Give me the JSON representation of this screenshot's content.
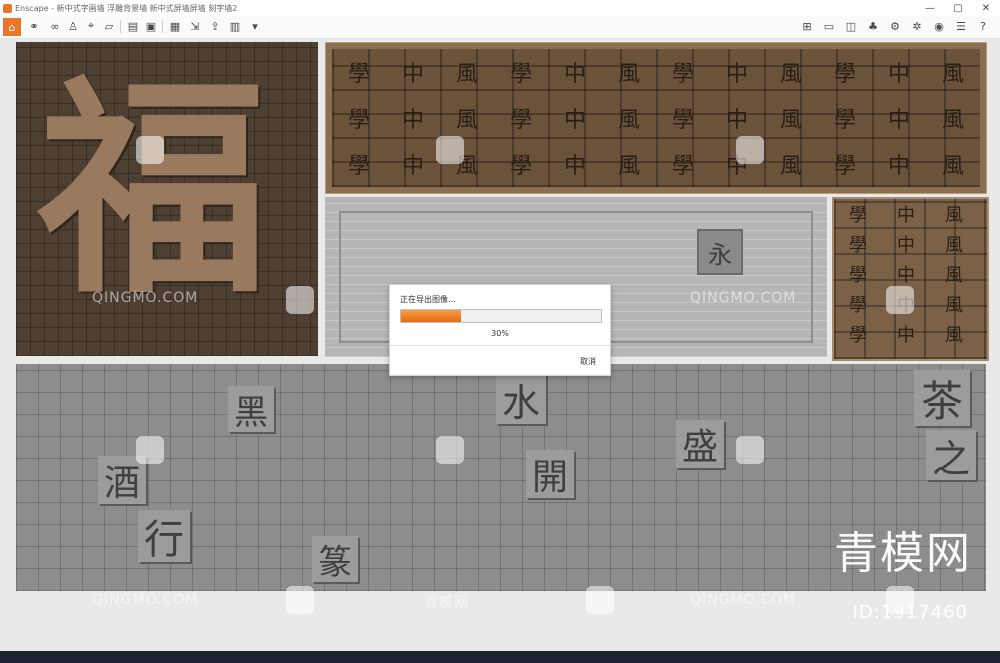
{
  "app": {
    "title": "Enscape - 新中式字画墙 浮雕背景墙 新中式屏墙屏墙 刻字墙2",
    "window_controls": [
      "—",
      "▢",
      "✕"
    ],
    "accent": "#e8762b"
  },
  "toolbar": {
    "left_icons": [
      "home-icon",
      "link-icon",
      "binoculars-icon",
      "person-icon",
      "map-pin-icon",
      "bookmark-icon",
      "clapper-icon",
      "screenshot-icon",
      "batch-render-icon",
      "export-icon",
      "upload-icon",
      "layout-icon"
    ],
    "right_icons": [
      "map-icon",
      "panorama-icon",
      "cube-icon",
      "assets-icon",
      "settings-icon",
      "eye-icon",
      "gear-icon",
      "help-icon"
    ]
  },
  "scene": {
    "dark_panel_glyph": "福",
    "wood_seals": [
      "學",
      "中",
      "風",
      "學",
      "中",
      "風",
      "學",
      "中",
      "風",
      "學",
      "中",
      "風",
      "學",
      "中",
      "風",
      "學",
      "中",
      "風",
      "學",
      "中",
      "風",
      "學",
      "中",
      "風",
      "學",
      "中",
      "風",
      "學",
      "中",
      "風",
      "學",
      "中",
      "風",
      "學",
      "中",
      "風"
    ],
    "small_wood_seals": [
      "學",
      "中",
      "風",
      "學",
      "中",
      "風",
      "學",
      "中",
      "風",
      "學",
      "中",
      "風",
      "學",
      "中",
      "風"
    ],
    "grey_box_glyph": "永",
    "stone_chars": [
      "黑",
      "水",
      "茶",
      "之",
      "酒",
      "行",
      "盛",
      "開",
      "篆"
    ],
    "watermark": "QINGMO.COM",
    "watermark_cn": "青模网",
    "brand": "青模网",
    "id_label": "ID:1917460"
  },
  "dialog": {
    "message": "正在导出图像...",
    "progress": 0.3,
    "percent_label": "30%",
    "cancel_label": "取消"
  }
}
